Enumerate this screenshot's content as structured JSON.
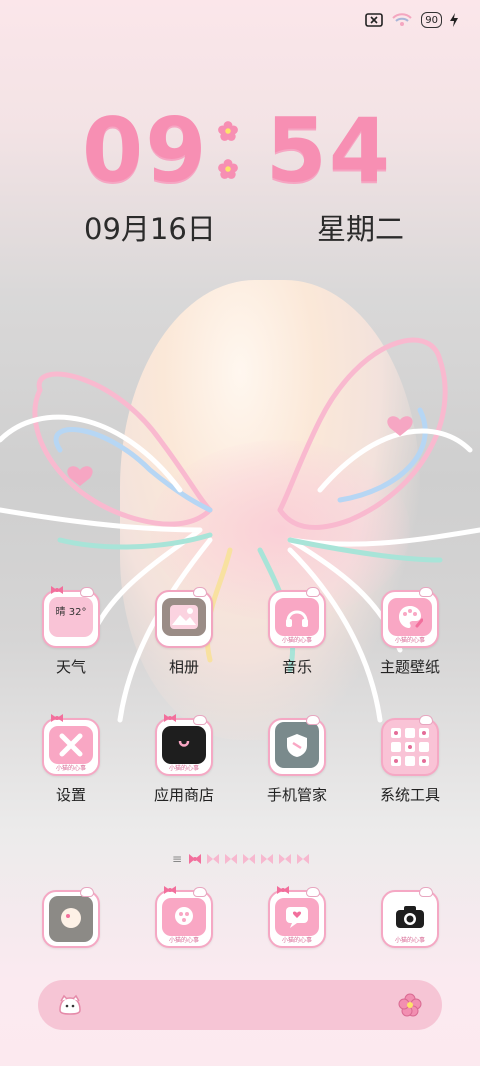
{
  "status_bar": {
    "battery_level": "90",
    "icons": [
      "sim-off-icon",
      "wifi-icon",
      "battery-icon",
      "charging-icon"
    ]
  },
  "clock": {
    "hours": "09",
    "minutes": "54",
    "date": "09月16日",
    "weekday": "星期二"
  },
  "apps_row1": [
    {
      "label": "天气",
      "icon": "weather-icon",
      "detail": "晴 32°"
    },
    {
      "label": "相册",
      "icon": "gallery-icon"
    },
    {
      "label": "音乐",
      "icon": "music-icon"
    },
    {
      "label": "主题壁纸",
      "icon": "theme-icon"
    }
  ],
  "apps_row2": [
    {
      "label": "设置",
      "icon": "settings-icon"
    },
    {
      "label": "应用商店",
      "icon": "app-store-icon"
    },
    {
      "label": "手机管家",
      "icon": "phone-manager-icon"
    },
    {
      "label": "系统工具",
      "icon": "system-tools-icon"
    }
  ],
  "dock": [
    {
      "icon": "photo-app-icon"
    },
    {
      "icon": "flower-app-icon"
    },
    {
      "icon": "messages-app-icon"
    },
    {
      "icon": "camera-app-icon"
    }
  ],
  "icon_tag": "小猫的心事",
  "pager": {
    "total_pages": 7,
    "current_page": 1
  },
  "colors": {
    "accent_pink": "#f78fb3",
    "icon_border": "#f5a8c4",
    "dock_bar": "#f6c5d5"
  }
}
